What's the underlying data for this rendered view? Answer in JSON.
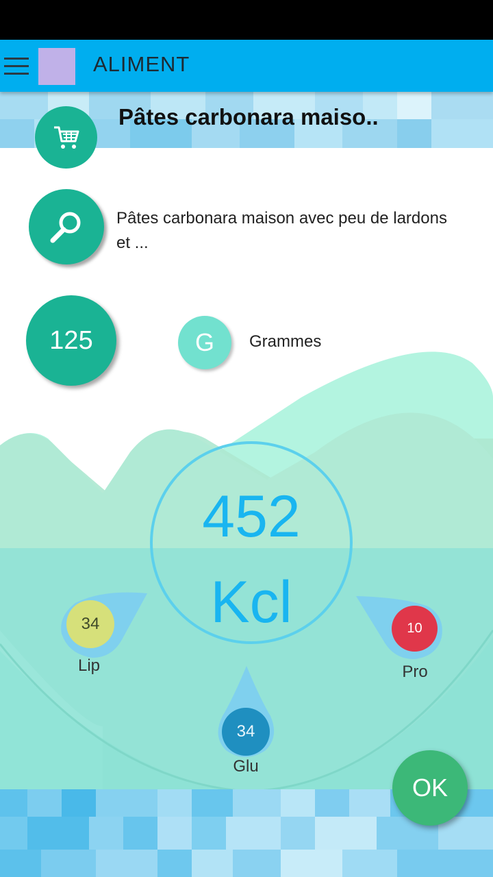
{
  "app_bar": {
    "title": "ALIMENT"
  },
  "food": {
    "title": "Pâtes carbonara maiso..",
    "description": "Pâtes carbonara maison avec peu de lardons et ..."
  },
  "quantity": {
    "value": "125",
    "unit_short": "G",
    "unit_label": "Grammes"
  },
  "energy": {
    "value": "452",
    "unit": "Kcl"
  },
  "macros": {
    "lip": {
      "value": "34",
      "label": "Lip"
    },
    "glu": {
      "value": "34",
      "label": "Glu"
    },
    "pro": {
      "value": "10",
      "label": "Pro"
    }
  },
  "actions": {
    "ok_label": "OK"
  },
  "colors": {
    "app_bar": "#00aeef",
    "primary_teal": "#1ab394",
    "unit_button": "#72e1cf",
    "ok_button": "#3cb878",
    "kcal_text": "#19b5f0",
    "lip": "#d6e07a",
    "glu": "#1f8fc0",
    "pro": "#e0374a"
  }
}
